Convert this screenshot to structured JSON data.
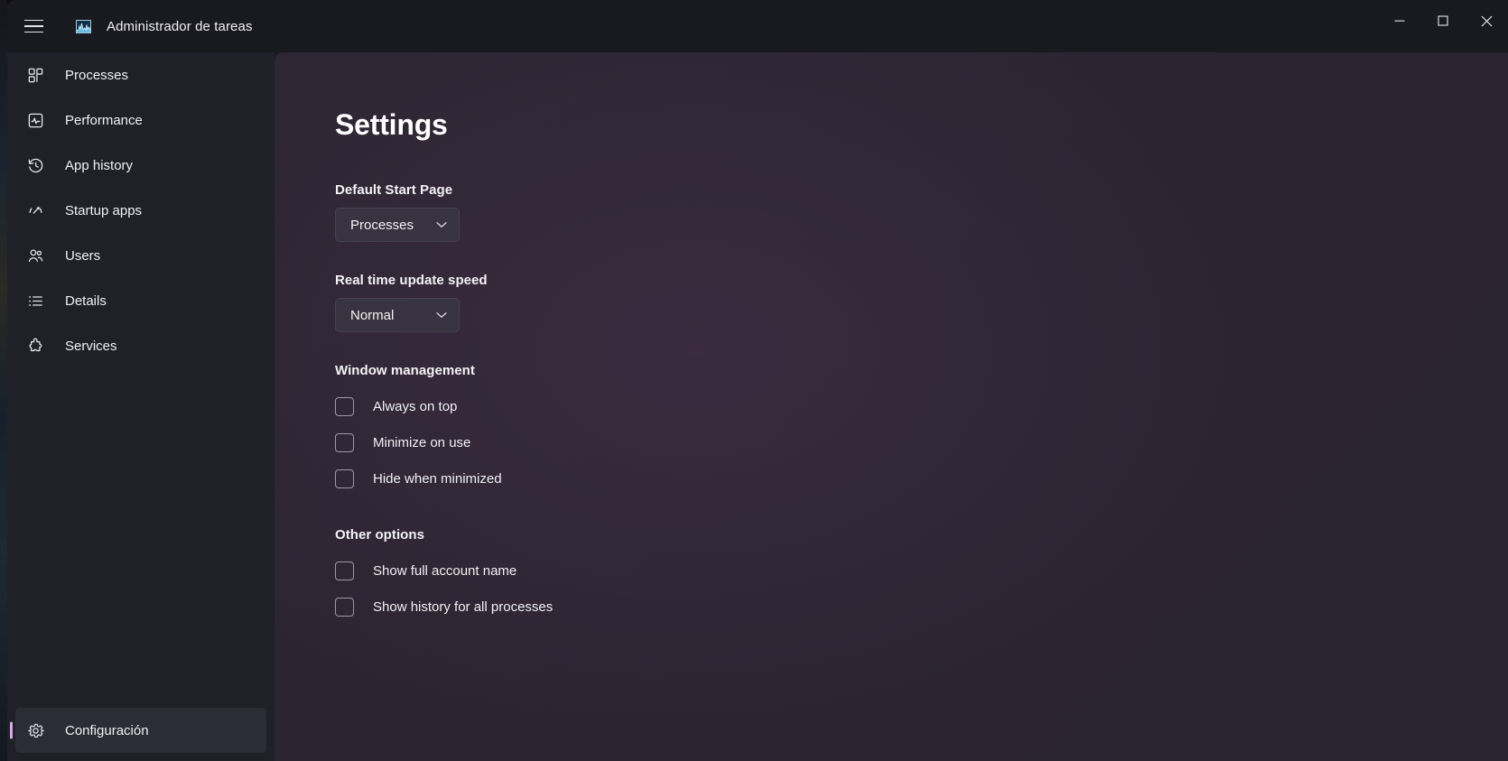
{
  "window": {
    "app_title": "Administrador de tareas",
    "app_icon": "task-manager-graph-icon",
    "menu_icon": "hamburger-menu-icon",
    "controls": {
      "minimize": "minimize-icon",
      "maximize": "maximize-icon",
      "close": "close-icon"
    }
  },
  "sidebar": {
    "items": [
      {
        "label": "Processes",
        "icon": "processes-grid-icon"
      },
      {
        "label": "Performance",
        "icon": "performance-pulse-icon"
      },
      {
        "label": "App history",
        "icon": "app-history-clock-icon"
      },
      {
        "label": "Startup apps",
        "icon": "startup-apps-speedometer-icon"
      },
      {
        "label": "Users",
        "icon": "users-people-icon"
      },
      {
        "label": "Details",
        "icon": "details-list-icon"
      },
      {
        "label": "Services",
        "icon": "services-puzzle-icon"
      }
    ],
    "bottom": {
      "label": "Configuración",
      "icon": "gear-icon",
      "selected": true,
      "accent_color": "#d9a6e8"
    }
  },
  "main": {
    "title": "Settings",
    "default_start_page": {
      "label": "Default Start Page",
      "value": "Processes",
      "chevron": "chevron-down-icon"
    },
    "update_speed": {
      "label": "Real time update speed",
      "value": "Normal",
      "chevron": "chevron-down-icon"
    },
    "window_management": {
      "label": "Window management",
      "options": [
        {
          "label": "Always on top",
          "checked": false
        },
        {
          "label": "Minimize on use",
          "checked": false
        },
        {
          "label": "Hide when minimized",
          "checked": false
        }
      ]
    },
    "other_options": {
      "label": "Other options",
      "options": [
        {
          "label": "Show full account name",
          "checked": false
        },
        {
          "label": "Show history for all processes",
          "checked": false
        }
      ]
    }
  },
  "colors": {
    "sidebar_bg": "#202029",
    "titlebar_bg": "#191920",
    "content_bg": "#2d2532",
    "accent": "#d9a6e8",
    "text": "#f1f1f4"
  }
}
